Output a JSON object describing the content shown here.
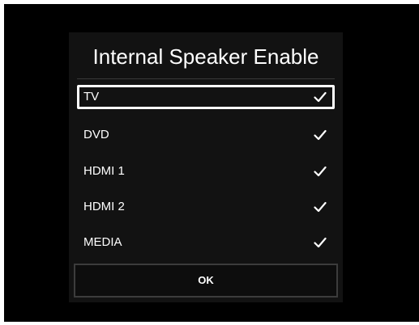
{
  "dialog": {
    "title": "Internal Speaker Enable",
    "options": [
      {
        "label": "TV",
        "checked": true,
        "focused": true
      },
      {
        "label": "DVD",
        "checked": true,
        "focused": false
      },
      {
        "label": "HDMI 1",
        "checked": true,
        "focused": false
      },
      {
        "label": "HDMI 2",
        "checked": true,
        "focused": false
      },
      {
        "label": "MEDIA",
        "checked": true,
        "focused": false
      }
    ],
    "ok_label": "OK"
  },
  "icons": {
    "check": "check-icon"
  },
  "colors": {
    "screen_background": "#000000",
    "dialog_background": "#121212",
    "text": "#ffffff",
    "focus_border": "#ffffff"
  }
}
